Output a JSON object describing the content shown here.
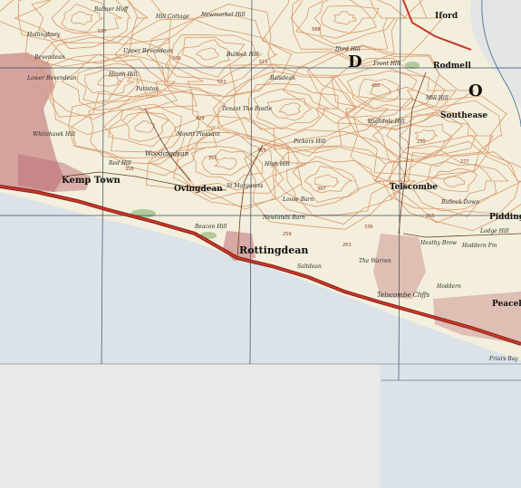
{
  "colors": {
    "land": "#f3efdc",
    "sea": "#dbe3e8",
    "blank": "#e9e9e9",
    "contour": "#d9986b",
    "road_main": "#c8362a",
    "road_edge": "#7a1d15",
    "grid": "#3a4a66",
    "urban": "#b9646b",
    "wood": "#9fc08a",
    "text": "#2b2b2b"
  },
  "places": {
    "hollingbury": "Hollingbury",
    "bevendean": "Bevendean",
    "lower_bevendean": "Lower Bevendean",
    "whitehawk_hill": "Whitehawk Hill",
    "kemp_town": "Kemp Town",
    "ovingdean": "Ovingdean",
    "woodingdean": "Woodingdean",
    "rottingdean": "Rottingdean",
    "balsdean": "Balsdean",
    "bullock_hill": "Bullock Hill",
    "high_hill": "High Hill",
    "telscombe": "Telscombe",
    "telscombe_cliffs": "Telscombe Cliffs",
    "rodmell": "Rodmell",
    "southease": "Southease",
    "piddinghoe": "Piddingho",
    "peacehaven": "Peaceh",
    "iford": "Iford",
    "iford_hill": "Iford Hill",
    "front_hill": "Front Hill",
    "mill_hill": "Mill Hill",
    "highdole_hill": "Highdole Hill",
    "pickers_hill": "Pickers Hill",
    "bullock_down": "Bullock Down",
    "saltdean": "Saltdean",
    "the_warren": "The Warren",
    "hoddern": "Hoddern",
    "hoddern_farm": "Hoddern Fm",
    "lodge_hill": "Lodge Hill",
    "friars_bay": "Friars Bay",
    "heathy_brow": "Heathy Brow",
    "lower_barn": "Loose Barn",
    "newlands_barn": "Newlands Barn",
    "st_margarets": "St Margarets",
    "the_rookery": "Tenant The Bostle",
    "mount_pleasant": "Mount Pleasant",
    "red_hill": "Red Hill",
    "hill_cottage": "Hill Cottage",
    "upper_bevendean": "Upper Bevendean",
    "heath_hill": "Heath Hill",
    "newmarket_hill": "Newmarket Hill",
    "pariston": "Pariston",
    "beacon_hill": "Beacon Hill",
    "balmer_huff": "Balmer Huff"
  },
  "spot_heights": [
    "537",
    "569",
    "563",
    "515",
    "588",
    "450",
    "358",
    "429",
    "365",
    "397",
    "263",
    "336",
    "259",
    "277",
    "230",
    "255",
    "356"
  ],
  "map_letters": [
    "D",
    "O"
  ]
}
